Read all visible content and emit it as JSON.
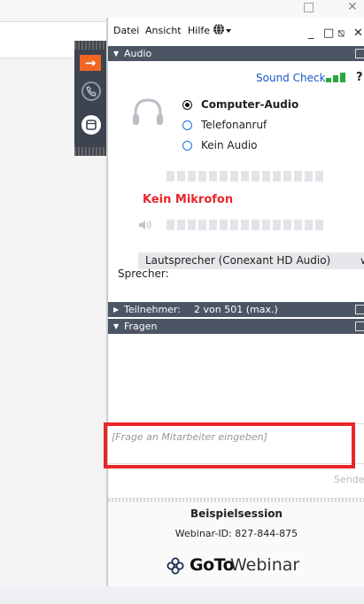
{
  "menu": {
    "file": "Datei",
    "view": "Ansicht",
    "help": "Hilfe"
  },
  "window_controls": {
    "minimize": "_",
    "maximize": "□",
    "popout": "⧅",
    "close": "✕"
  },
  "bg_window": {
    "maximize": "□",
    "close": "✕"
  },
  "audio": {
    "header": "Audio",
    "sound_check": "Sound Check",
    "help_mark": "?",
    "options": [
      "Computer-Audio",
      "Telefonanruf",
      "Kein Audio"
    ],
    "selected": "Computer-Audio",
    "mic_status": "Kein Mikrofon",
    "speaker_device": "Lautsprecher (Conexant HD Audio)",
    "speaker_label": "Sprecher:"
  },
  "participants": {
    "header": "Teilnehmer:",
    "count": "2 von 501 (max.)"
  },
  "questions": {
    "header": "Fragen",
    "placeholder": "[Frage an Mitarbeiter eingeben]",
    "send_label": "Senden"
  },
  "session": {
    "title": "Beispielsession",
    "webinar_id": "Webinar-ID: 827-844-875",
    "brand_bold": "GoTo",
    "brand_light": "Webinar"
  },
  "colors": {
    "accent_orange": "#f26522",
    "header_bg": "#4c5564",
    "mic_red": "#e8262a",
    "highlight_red": "#e8262a",
    "link_blue": "#1a56c8",
    "signal_green": "#2aa83a"
  }
}
